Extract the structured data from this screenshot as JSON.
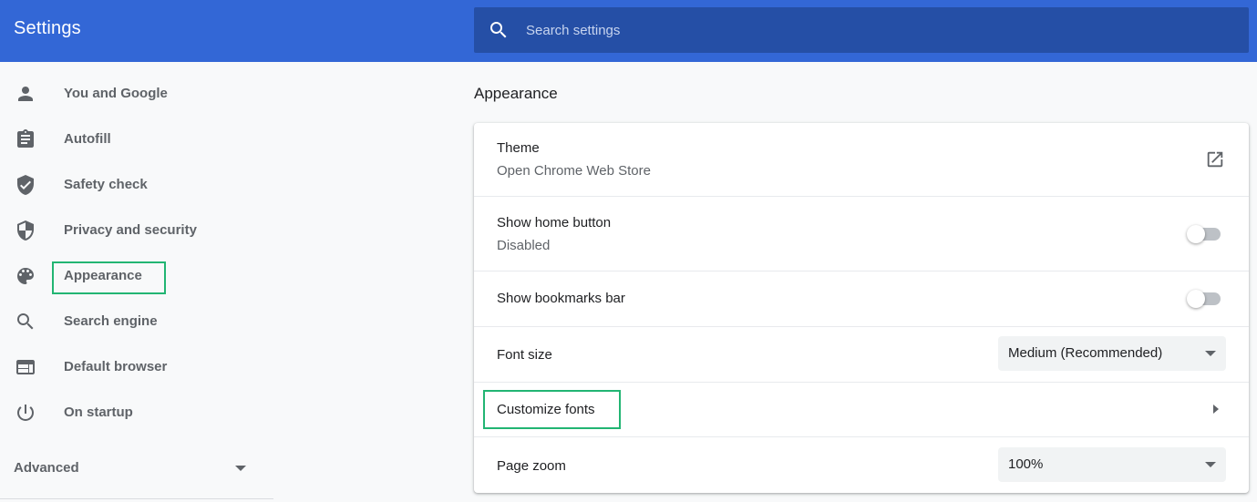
{
  "header": {
    "title": "Settings",
    "search_placeholder": "Search settings",
    "search_icon": "search-icon"
  },
  "colors": {
    "header_bg": "#3367d6",
    "search_bg": "#254fa6",
    "highlight": "#22b573",
    "page_bg": "#f8f9fa"
  },
  "sidebar": {
    "items": [
      {
        "label": "You and Google",
        "icon": "person-icon"
      },
      {
        "label": "Autofill",
        "icon": "clipboard-icon"
      },
      {
        "label": "Safety check",
        "icon": "shield-check-icon"
      },
      {
        "label": "Privacy and security",
        "icon": "shield-half-icon"
      },
      {
        "label": "Appearance",
        "icon": "palette-icon",
        "highlighted": true
      },
      {
        "label": "Search engine",
        "icon": "search-icon"
      },
      {
        "label": "Default browser",
        "icon": "browser-window-icon"
      },
      {
        "label": "On startup",
        "icon": "power-icon"
      }
    ],
    "advanced_label": "Advanced"
  },
  "main": {
    "section_title": "Appearance",
    "theme": {
      "title": "Theme",
      "subtitle": "Open Chrome Web Store",
      "icon": "open-in-new-icon"
    },
    "home_button": {
      "title": "Show home button",
      "subtitle": "Disabled",
      "enabled": false
    },
    "bookmarks_bar": {
      "title": "Show bookmarks bar",
      "enabled": false
    },
    "font_size": {
      "title": "Font size",
      "value": "Medium (Recommended)"
    },
    "customize_fonts": {
      "title": "Customize fonts",
      "highlighted": true
    },
    "page_zoom": {
      "title": "Page zoom",
      "value": "100%"
    }
  }
}
